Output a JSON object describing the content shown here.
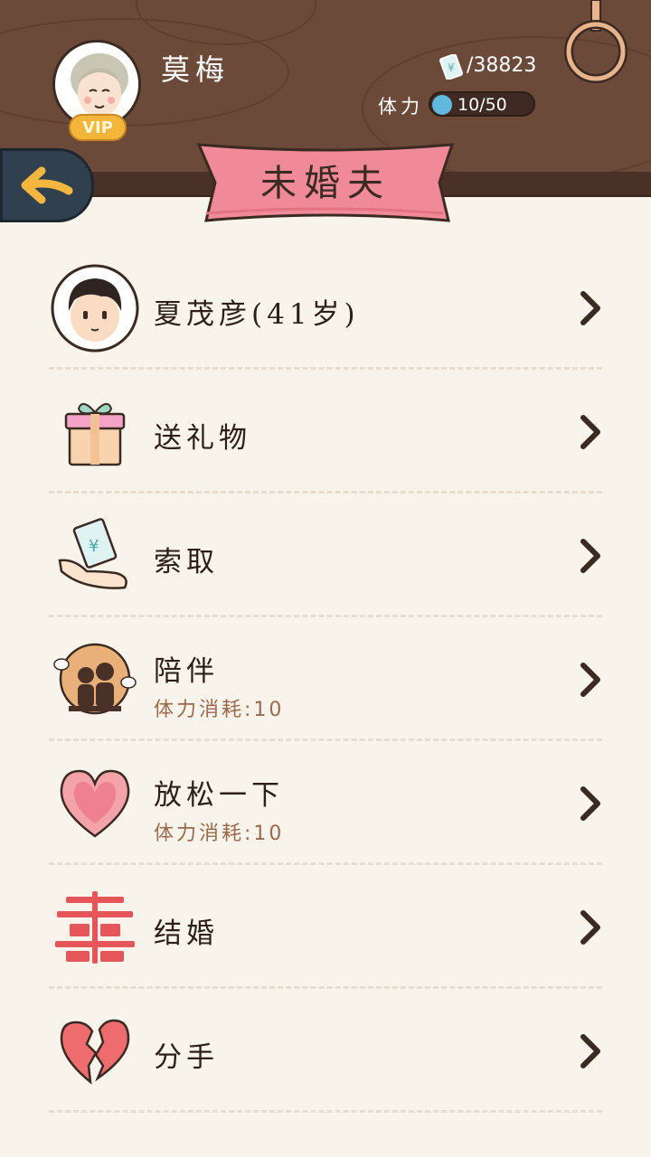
{
  "header": {
    "user_name": "莫梅",
    "vip_label": "VIP",
    "money_value": "/38823",
    "stamina_label": "体力",
    "stamina_value": "10/50",
    "page_title": "未婚夫"
  },
  "rows": [
    {
      "title": "夏茂彦(41岁)",
      "subtitle": "",
      "icon": "man-avatar-icon"
    },
    {
      "title": "送礼物",
      "subtitle": "",
      "icon": "gift-box-icon"
    },
    {
      "title": "索取",
      "subtitle": "",
      "icon": "hand-money-icon"
    },
    {
      "title": "陪伴",
      "subtitle": "体力消耗:10",
      "icon": "couple-silhouette-icon"
    },
    {
      "title": "放松一下",
      "subtitle": "体力消耗:10",
      "icon": "heart-icon"
    },
    {
      "title": "结婚",
      "subtitle": "",
      "icon": "double-happiness-icon"
    },
    {
      "title": "分手",
      "subtitle": "",
      "icon": "broken-heart-icon"
    }
  ],
  "colors": {
    "header_wood": "#6b4a3a",
    "banner_pink": "#f08a98",
    "background": "#f8f4ec",
    "stamina_blue": "#61b9e0",
    "back_button": "#31404f"
  }
}
